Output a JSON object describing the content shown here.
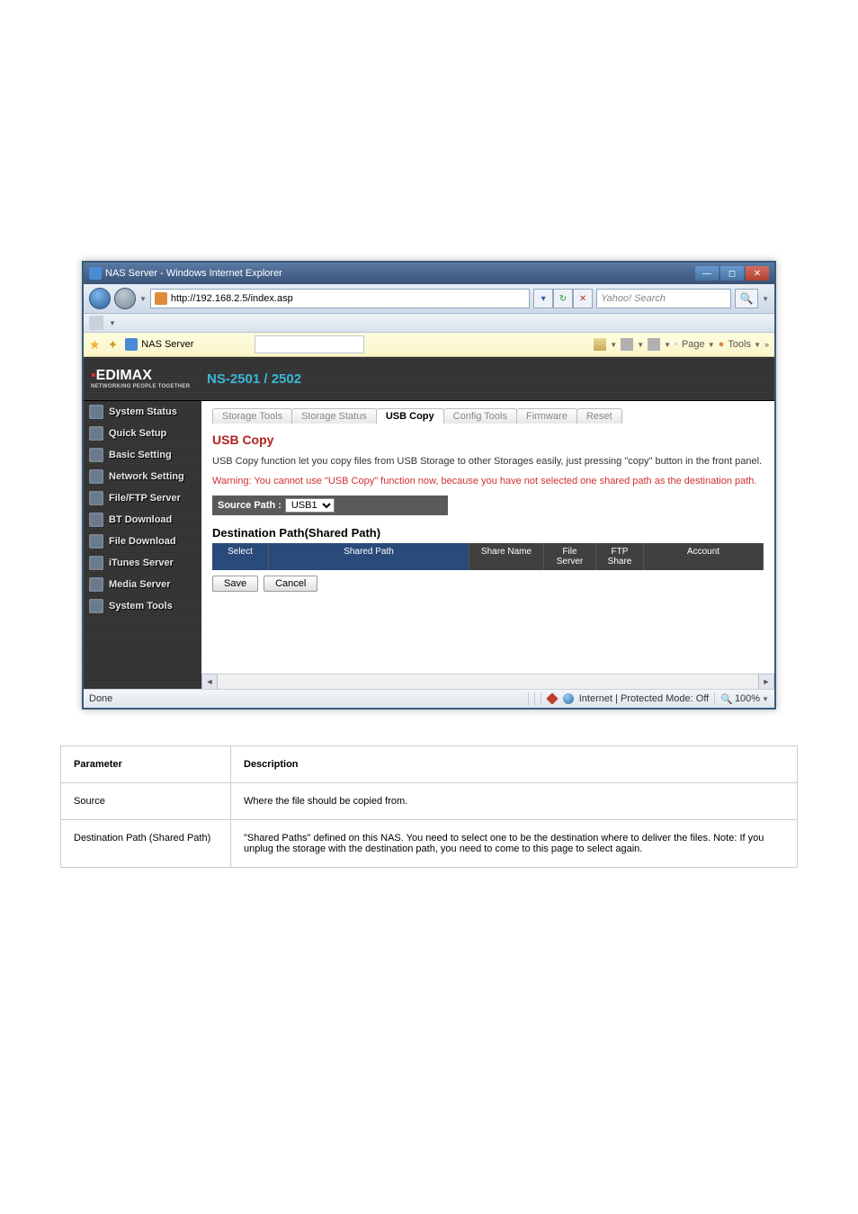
{
  "window": {
    "title": "NAS Server - Windows Internet Explorer",
    "url": "http://192.168.2.5/index.asp",
    "search_placeholder": "Yahoo! Search"
  },
  "tabbar": {
    "active_tab": "NAS Server",
    "page_label": "Page",
    "tools_label": "Tools"
  },
  "app": {
    "brand_main": "EDIMAX",
    "brand_sub": "NETWORKING PEOPLE TOGETHER",
    "model": "NS-2501 / 2502"
  },
  "sidebar": {
    "items": [
      {
        "label": "System Status"
      },
      {
        "label": "Quick Setup"
      },
      {
        "label": "Basic Setting"
      },
      {
        "label": "Network Setting"
      },
      {
        "label": "File/FTP Server"
      },
      {
        "label": "BT Download"
      },
      {
        "label": "File Download"
      },
      {
        "label": "iTunes Server"
      },
      {
        "label": "Media Server"
      },
      {
        "label": "System Tools"
      }
    ]
  },
  "tabs": [
    {
      "label": "Storage Tools"
    },
    {
      "label": "Storage Status"
    },
    {
      "label": "USB Copy"
    },
    {
      "label": "Config Tools"
    },
    {
      "label": "Firmware"
    },
    {
      "label": "Reset"
    }
  ],
  "content": {
    "title": "USB Copy",
    "description": "USB Copy function let you copy files from USB Storage to other Storages easily, just pressing \"copy\" button in the front panel.",
    "warning": "Warning: You cannot use \"USB Copy\" function now, because you have not selected one shared path as the destination path.",
    "source_label": "Source Path :",
    "source_value": "USB1",
    "dest_title": "Destination Path(Shared Path)",
    "columns": {
      "select": "Select",
      "path": "Shared Path",
      "name": "Share Name",
      "fs": "File Server",
      "ftp": "FTP Share",
      "acct": "Account"
    },
    "save_label": "Save",
    "cancel_label": "Cancel"
  },
  "status": {
    "done": "Done",
    "zone": "Internet | Protected Mode: Off",
    "zoom": "100%"
  },
  "help": {
    "parameter_label": "Parameter",
    "description_label": "Description",
    "rows": [
      {
        "param": "Source",
        "desc": "Where the file should be copied from."
      },
      {
        "param": "Destination Path (Shared Path)",
        "desc": "\"Shared Paths\" defined on this NAS. You need to select one to be the destination where to deliver the files. Note: If you unplug the storage with the destination path, you need to come to this page to select again."
      }
    ]
  }
}
